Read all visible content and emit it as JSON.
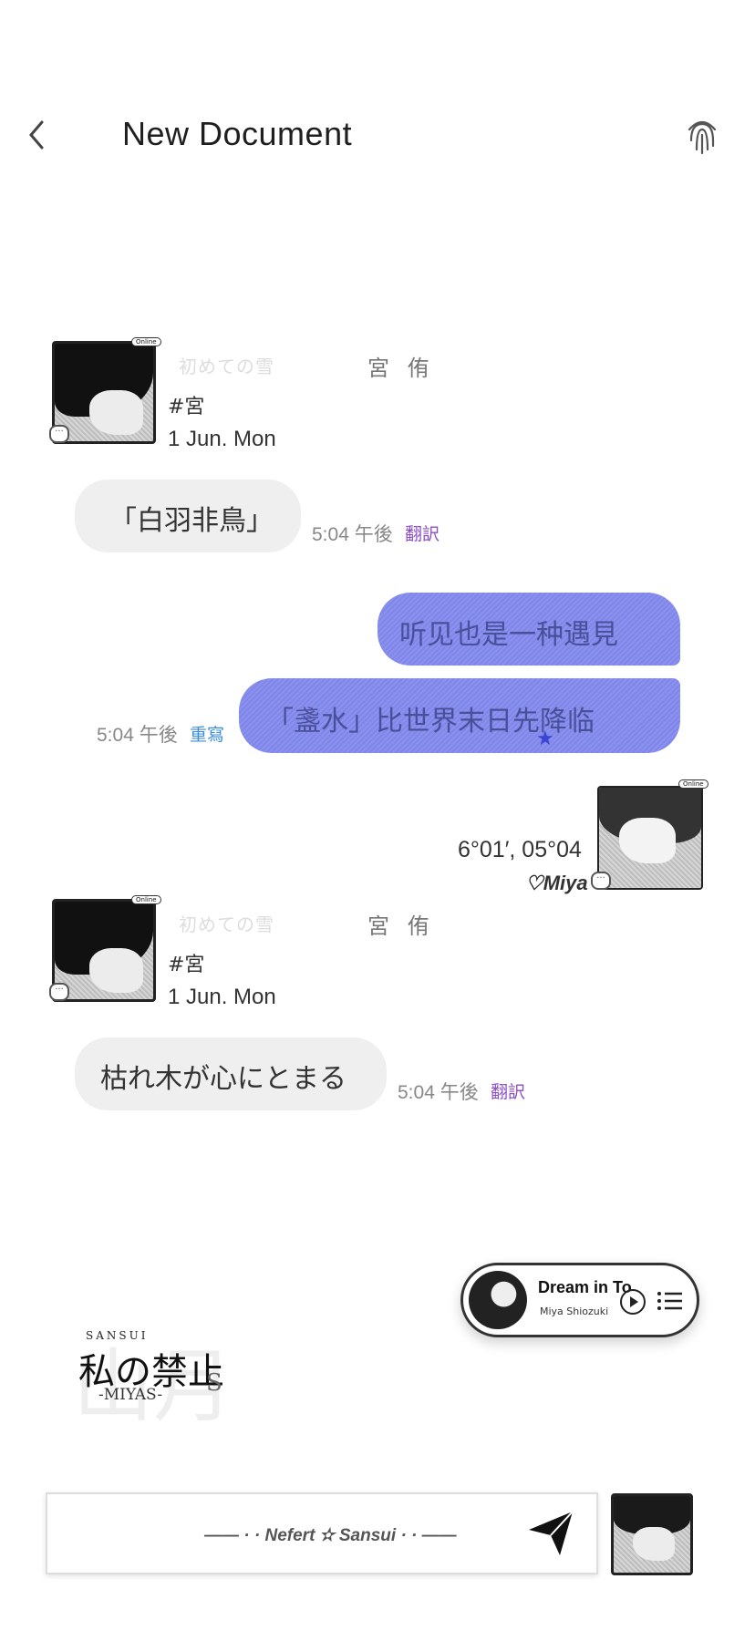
{
  "header": {
    "title": "New Document"
  },
  "messages": [
    {
      "sender": {
        "name": "宮 侑",
        "decor": "初めての雪",
        "tag": "#宮",
        "date": "1 Jun. Mon",
        "badge": "Online"
      },
      "text": "「白羽非鳥」",
      "time": "5:04 午後",
      "action": "翻訳"
    },
    {
      "outgoing": true,
      "lines": [
        "听见也是一种遇見",
        "「盞水」比世界末日先降临"
      ],
      "time": "5:04 午後",
      "action": "重寫"
    },
    {
      "right_profile": {
        "coords": "6°01′, 05°04",
        "name": "♡Miya",
        "badge": "Online"
      }
    },
    {
      "sender": {
        "name": "宮 侑",
        "decor": "初めての雪",
        "tag": "#宮",
        "date": "1 Jun. Mon",
        "badge": "Online"
      },
      "text": "枯れ木が心にとまる",
      "time": "5:04 午後",
      "action": "翻訳"
    }
  ],
  "music": {
    "song": "Dream in To",
    "artist": "Miya Shiozuki"
  },
  "logo": {
    "top": "SANSUI",
    "main": "私の禁止",
    "sub": "-MIYAS-",
    "letter": "S"
  },
  "input": {
    "placeholder": "—— · · Nefert ✫ Sansui · · ——"
  },
  "colors": {
    "bubble_out": "#7f86e8",
    "translate": "#8b4dc7",
    "rewrite": "#3a8ee0"
  }
}
